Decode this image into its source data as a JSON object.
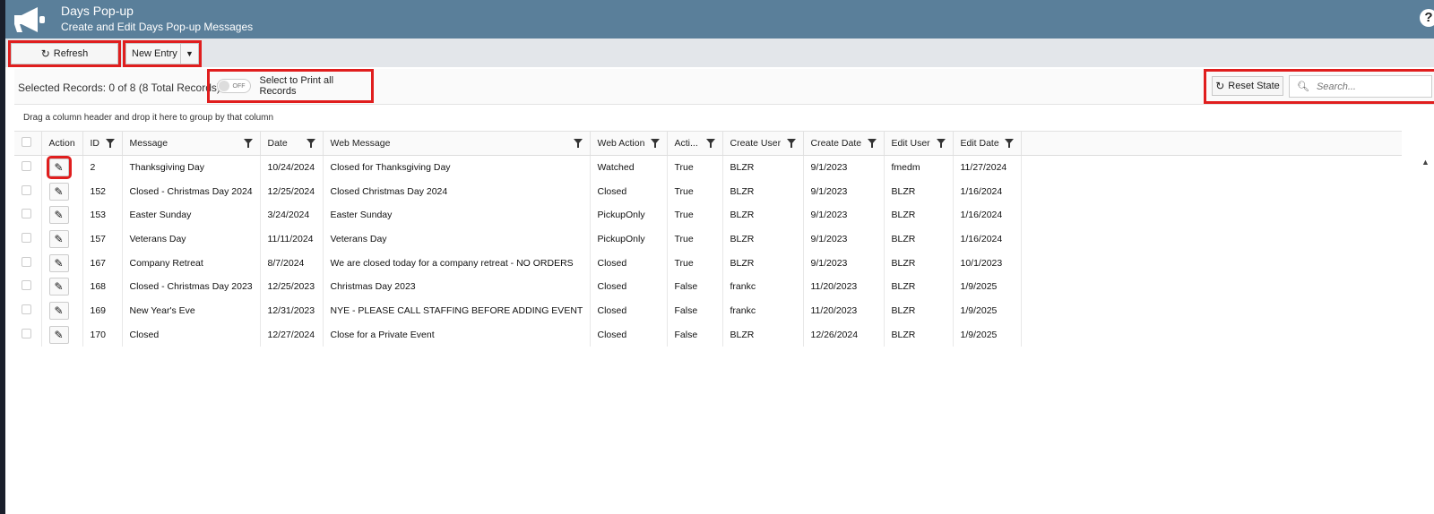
{
  "header": {
    "title": "Days Pop-up",
    "subtitle": "Create and Edit Days Pop-up Messages",
    "help": "?"
  },
  "toolbar": {
    "refresh_label": "Refresh",
    "new_entry_label": "New Entry"
  },
  "info": {
    "selected_text": "Selected Records: 0 of 8 (8 Total Records)",
    "toggle_state": "OFF",
    "toggle_label": "Select to Print all Records",
    "reset_label": "Reset State",
    "search_placeholder": "Search..."
  },
  "grid": {
    "group_hint": "Drag a column header and drop it here to group by that column",
    "columns": [
      "Action",
      "ID",
      "Message",
      "Date",
      "Web Message",
      "Web Action",
      "Acti...",
      "Create User",
      "Create Date",
      "Edit User",
      "Edit Date"
    ],
    "rows": [
      [
        "2",
        "Thanksgiving Day",
        "10/24/2024",
        "Closed for Thanksgiving Day",
        "Watched",
        "True",
        "BLZR",
        "9/1/2023",
        "fmedm",
        "11/27/2024"
      ],
      [
        "152",
        "Closed - Christmas Day 2024",
        "12/25/2024",
        "Closed Christmas Day 2024",
        "Closed",
        "True",
        "BLZR",
        "9/1/2023",
        "BLZR",
        "1/16/2024"
      ],
      [
        "153",
        "Easter Sunday",
        "3/24/2024",
        "Easter Sunday",
        "PickupOnly",
        "True",
        "BLZR",
        "9/1/2023",
        "BLZR",
        "1/16/2024"
      ],
      [
        "157",
        "Veterans Day",
        "11/11/2024",
        "Veterans Day",
        "PickupOnly",
        "True",
        "BLZR",
        "9/1/2023",
        "BLZR",
        "1/16/2024"
      ],
      [
        "167",
        "Company Retreat",
        "8/7/2024",
        "We are closed today for a company retreat - NO ORDERS",
        "Closed",
        "True",
        "BLZR",
        "9/1/2023",
        "BLZR",
        "10/1/2023"
      ],
      [
        "168",
        "Closed - Christmas Day 2023",
        "12/25/2023",
        "Christmas Day 2023",
        "Closed",
        "False",
        "frankc",
        "11/20/2023",
        "BLZR",
        "1/9/2025"
      ],
      [
        "169",
        "New Year's Eve",
        "12/31/2023",
        "NYE - PLEASE CALL STAFFING BEFORE ADDING EVENT",
        "Closed",
        "False",
        "frankc",
        "11/20/2023",
        "BLZR",
        "1/9/2025"
      ],
      [
        "170",
        "Closed",
        "12/27/2024",
        "Close for a Private Event",
        "Closed",
        "False",
        "BLZR",
        "12/26/2024",
        "BLZR",
        "1/9/2025"
      ]
    ]
  }
}
